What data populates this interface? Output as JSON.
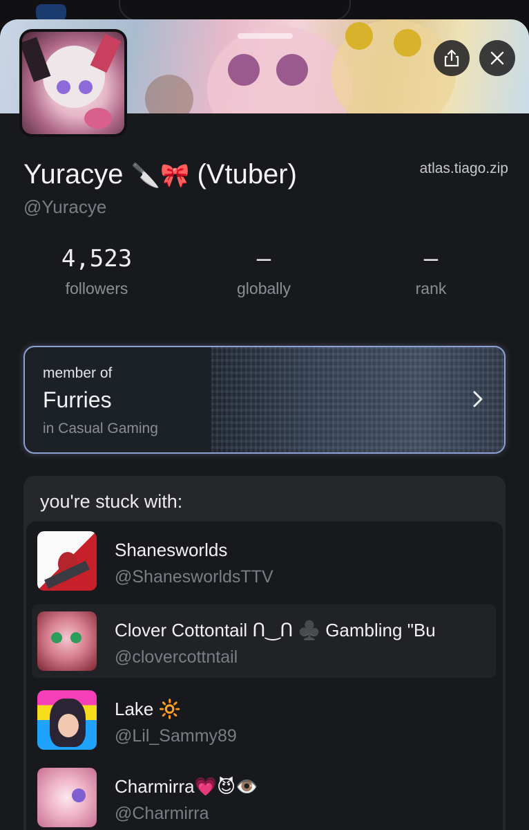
{
  "profile": {
    "name": "Yuracye",
    "name_emoji": "🔪🎀",
    "name_suffix": "(Vtuber)",
    "handle": "@Yuracye",
    "site": "atlas.tiago.zip"
  },
  "stats": [
    {
      "value": "4,523",
      "label": "followers"
    },
    {
      "value": "–",
      "label": "globally"
    },
    {
      "value": "–",
      "label": "rank"
    }
  ],
  "membership": {
    "caption": "member of",
    "group": "Furries",
    "category": "in Casual Gaming"
  },
  "stuck": {
    "title": "you're stuck with:",
    "items": [
      {
        "name": "Shanesworlds",
        "handle": "@ShanesworldsTTV"
      },
      {
        "name": "Clover Cottontail ᑎ‿ᑎ ♣️ Gambling \"Bu",
        "handle": "@clovercottntail"
      },
      {
        "name": "Lake 🔆",
        "handle": "@Lil_Sammy89"
      },
      {
        "name": "Charmirra💗😈👁️",
        "handle": "@Charmirra"
      }
    ]
  },
  "icons": {
    "share": "share-icon",
    "close": "close-icon",
    "chevron": "chevron-right-icon"
  },
  "colors": {
    "sheet_bg": "#18191c",
    "accent_border": "#8ea2d3",
    "muted_text": "#7b7d85"
  }
}
